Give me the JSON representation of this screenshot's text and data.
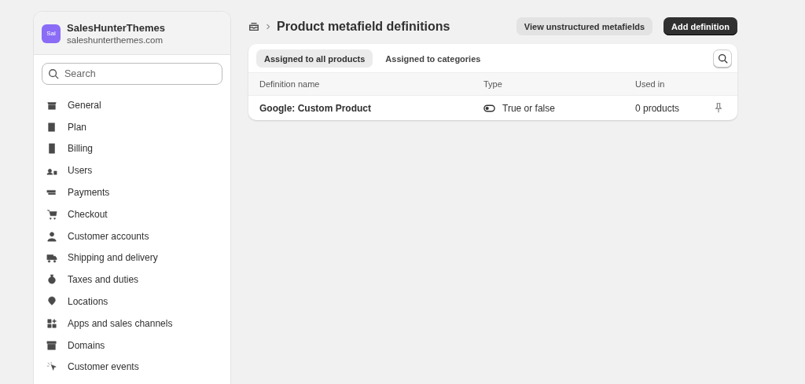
{
  "store": {
    "avatar": "Sal",
    "name": "SalesHunterThemes",
    "domain": "saleshunterthemes.com"
  },
  "sidebar": {
    "search": {
      "placeholder": "Search"
    },
    "items": [
      {
        "label": "General"
      },
      {
        "label": "Plan"
      },
      {
        "label": "Billing"
      },
      {
        "label": "Users"
      },
      {
        "label": "Payments"
      },
      {
        "label": "Checkout"
      },
      {
        "label": "Customer accounts"
      },
      {
        "label": "Shipping and delivery"
      },
      {
        "label": "Taxes and duties"
      },
      {
        "label": "Locations"
      },
      {
        "label": "Apps and sales channels"
      },
      {
        "label": "Domains"
      },
      {
        "label": "Customer events"
      }
    ]
  },
  "page": {
    "title": "Product metafield definitions",
    "buttons": [
      {
        "label": "View unstructured metafields",
        "kind": "secondary"
      },
      {
        "label": "Add definition",
        "kind": "primary"
      }
    ]
  },
  "tabs": [
    {
      "label": "Assigned to all products",
      "selected": true
    },
    {
      "label": "Assigned to categories",
      "selected": false
    }
  ],
  "table": {
    "columns": [
      "Definition name",
      "Type",
      "Used in"
    ],
    "rows": [
      {
        "name": "Google: Custom Product",
        "type": "True or false",
        "used_in": "0 products"
      }
    ]
  }
}
